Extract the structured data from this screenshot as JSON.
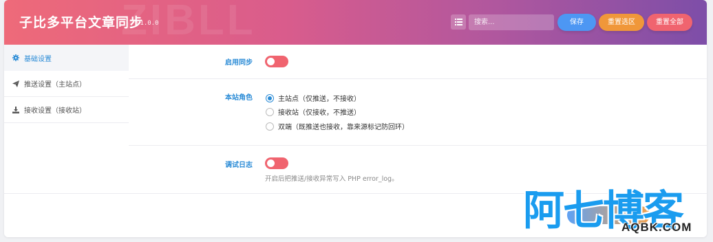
{
  "header": {
    "title": "子比多平台文章同步",
    "version": "v1.0.0",
    "search_placeholder": "搜索...",
    "save_label": "保存",
    "reset_section_label": "重置选区",
    "reset_all_label": "重置全部"
  },
  "sidebar": {
    "items": [
      {
        "label": "基础设置",
        "icon": "gear-icon",
        "active": true
      },
      {
        "label": "推送设置（主站点）",
        "icon": "paper-plane-icon",
        "active": false
      },
      {
        "label": "接收设置（接收站）",
        "icon": "download-icon",
        "active": false
      }
    ]
  },
  "settings": {
    "enable_sync": {
      "label": "启用同步",
      "enabled": false
    },
    "site_role": {
      "label": "本站角色",
      "options": [
        {
          "label": "主站点（仅推送，不接收）",
          "selected": true
        },
        {
          "label": "接收站（仅接收，不推送）",
          "selected": false
        },
        {
          "label": "双端（既推送也接收，靠来源标记防回环）",
          "selected": false
        }
      ]
    },
    "debug_log": {
      "label": "调试日志",
      "enabled": false,
      "hint": "开启后把推送/接收异常写入 PHP error_log。"
    }
  },
  "watermark": {
    "main": "阿七博客",
    "sub": "AQBK.COM"
  },
  "colors": {
    "accent_blue": "#2a8bd6",
    "save_button": "#4d97f3",
    "reset_section_button": "#f0973a",
    "reset_all_button": "#f0646f",
    "toggle_off": "#f0646f",
    "header_gradient_start": "#ee6a79",
    "header_gradient_end": "#7d4ea8"
  }
}
